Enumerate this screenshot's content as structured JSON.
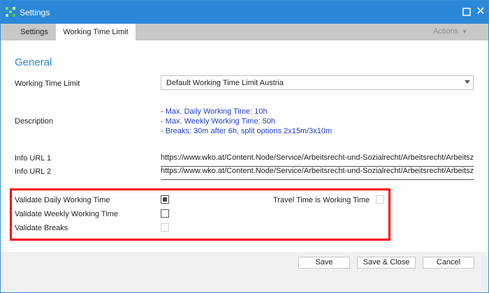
{
  "window": {
    "title": "Settings"
  },
  "tabs": [
    {
      "label": "Settings"
    },
    {
      "label": "Working Time Limit"
    }
  ],
  "actions": {
    "label": "Actions"
  },
  "general": {
    "title": "General",
    "working_time_limit": {
      "label": "Working Time Limit",
      "value": "Default Working Time Limit Austria"
    },
    "description": {
      "label": "Description",
      "lines": [
        "- Max. Daily Working Time: 10h",
        "- Max. Weekly Working Time: 50h",
        "- Breaks: 30m after 6h, split options 2x15m/3x10m"
      ]
    },
    "info_url_1": {
      "label": "Info URL 1",
      "value": "https://www.wko.at/Content.Node/Service/Arbeitsrecht-und-Sozialrecht/Arbeitsrecht/Arbeitszeit"
    },
    "info_url_2": {
      "label": "Info URL 2",
      "value": "https://www.wko.at/Content.Node/Service/Arbeitsrecht-und-Sozialrecht/Arbeitsrecht/Arbeitszeit"
    }
  },
  "validation": {
    "daily": {
      "label": "Validate Daily Working Time",
      "checked": true
    },
    "weekly": {
      "label": "Validate Weekly Working Time",
      "checked": false
    },
    "breaks": {
      "label": "Validate Breaks",
      "checked": false
    },
    "travel": {
      "label": "Travel Time is Working Time",
      "checked": false
    }
  },
  "footer": {
    "save": "Save",
    "save_close": "Save & Close",
    "cancel": "Cancel"
  },
  "colors": {
    "accent": "#2b88d8",
    "highlight_box": "#ff0000",
    "description_text": "#2240c8"
  },
  "icons": {
    "app": "app-logo-icon",
    "maximize": "maximize-icon",
    "close": "close-icon",
    "dropdown": "chevron-down-icon"
  }
}
